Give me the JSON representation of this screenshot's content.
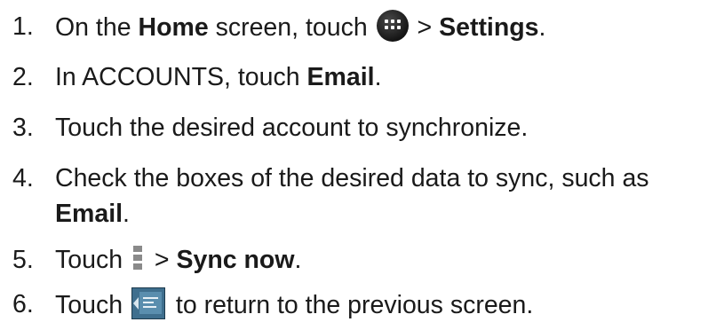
{
  "steps": [
    {
      "number": "1.",
      "pre": "On the ",
      "bold1": "Home",
      "mid": " screen, touch ",
      "icon": "home-menu-icon",
      "post": " > ",
      "bold2": "Settings",
      "end": "."
    },
    {
      "number": "2.",
      "pre": "In ACCOUNTS, touch ",
      "bold1": "Email",
      "end": "."
    },
    {
      "number": "3.",
      "text": "Touch the desired account to synchronize."
    },
    {
      "number": "4.",
      "text": "Check the boxes of the desired data to sync, such as",
      "bold_cont": "Email",
      "end": "."
    },
    {
      "number": "5.",
      "pre": "Touch ",
      "icon": "menu-vertical-icon",
      "post": " > ",
      "bold1": "Sync now",
      "end": "."
    },
    {
      "number": "6.",
      "pre": "Touch ",
      "icon": "back-app-icon",
      "post": " to return to the previous screen."
    }
  ]
}
